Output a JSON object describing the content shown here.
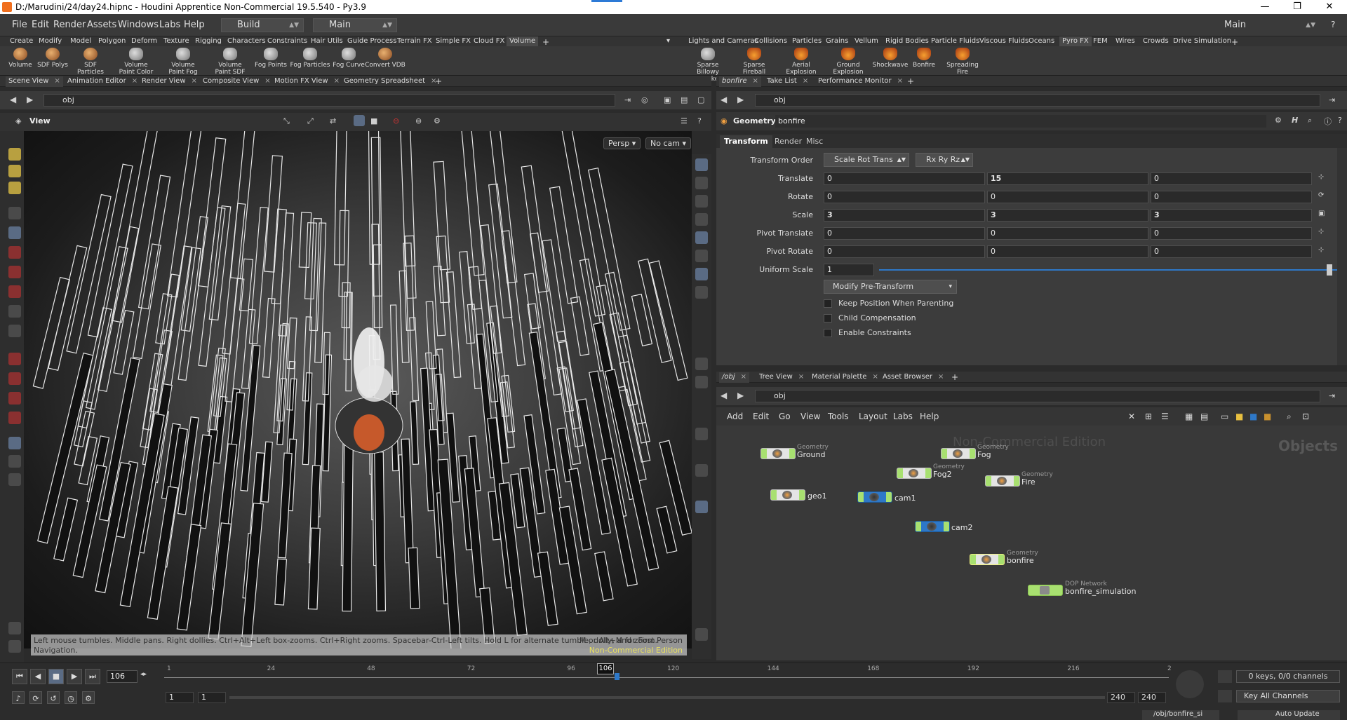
{
  "window": {
    "title": "D:/Marudini/24/day24.hipnc - Houdini Apprentice Non-Commercial 19.5.540 - Py3.9",
    "controls": [
      "—",
      "❐",
      "✕"
    ]
  },
  "menubar": {
    "items": [
      "File",
      "Edit",
      "Render",
      "Assets",
      "Windows",
      "Labs",
      "Help"
    ],
    "desktop": "Build",
    "context_left": "Main",
    "context_right": "Main"
  },
  "shelf_left": {
    "tabs": [
      "Create",
      "Modify",
      "Model",
      "Polygon",
      "Deform",
      "Texture",
      "Rigging",
      "Characters",
      "Constraints",
      "Hair Utils",
      "Guide Process",
      "Terrain FX",
      "Simple FX",
      "Cloud FX",
      "Volume"
    ],
    "active_tab": "Volume",
    "tools": [
      {
        "label": "Volume",
        "icon": "volume-icon"
      },
      {
        "label": "SDF Polys",
        "icon": "sdf-polys-icon"
      },
      {
        "label": "SDF Particles",
        "icon": "sdf-particles-icon"
      },
      {
        "label": "Volume Paint Color",
        "icon": "volume-paint-color-icon"
      },
      {
        "label": "Volume Paint Fog",
        "icon": "volume-paint-fog-icon"
      },
      {
        "label": "Volume Paint SDF",
        "icon": "volume-paint-sdf-icon"
      },
      {
        "label": "Fog Points",
        "icon": "fog-points-icon"
      },
      {
        "label": "Fog Particles",
        "icon": "fog-particles-icon"
      },
      {
        "label": "Fog Curve",
        "icon": "fog-curve-icon"
      },
      {
        "label": "Convert VDB",
        "icon": "convert-vdb-icon"
      }
    ]
  },
  "shelf_right": {
    "tabs": [
      "Lights and Cameras",
      "Collisions",
      "Particles",
      "Grains",
      "Vellum",
      "Rigid Bodies",
      "Particle Fluids",
      "Viscous Fluids",
      "Oceans",
      "Pyro FX",
      "FEM",
      "Wires",
      "Crowds",
      "Drive Simulation"
    ],
    "active_tab": "Pyro FX",
    "tools": [
      {
        "label": "Sparse Billowy Smoke",
        "icon": "billowy-smoke-icon"
      },
      {
        "label": "Sparse Fireball",
        "icon": "fireball-icon"
      },
      {
        "label": "Aerial Explosion",
        "icon": "aerial-explosion-icon"
      },
      {
        "label": "Ground Explosion",
        "icon": "ground-explosion-icon"
      },
      {
        "label": "Shockwave",
        "icon": "shockwave-icon"
      },
      {
        "label": "Bonfire",
        "icon": "bonfire-icon"
      },
      {
        "label": "Spreading Fire",
        "icon": "spreading-fire-icon"
      }
    ]
  },
  "left_pane": {
    "tabs": [
      "Scene View",
      "Animation Editor",
      "Render View",
      "Composite View",
      "Motion FX View",
      "Geometry Spreadsheet"
    ],
    "path": "obj",
    "view_title": "View",
    "persp_button": "Persp",
    "cam_button": "No cam",
    "status_message": "Left mouse tumbles. Middle pans. Right dollies. Ctrl+Alt+Left box-zooms. Ctrl+Right zooms. Spacebar-Ctrl-Left tilts. Hold L for alternate tumble, dolly, and zoom.",
    "status_message2": "Navigation.",
    "status_hint": "M or Alt+M for First Person",
    "watermark": "Non-Commercial Edition"
  },
  "param_pane": {
    "tabs": [
      "bonfire",
      "Take List",
      "Performance Monitor"
    ],
    "path": "obj",
    "node_type": "Geometry",
    "node_name": "bonfire",
    "param_tabs": [
      "Transform",
      "Render",
      "Misc"
    ],
    "active_param_tab": "Transform",
    "transform_order_label": "Transform Order",
    "transform_order": "Scale Rot Trans",
    "rotate_order": "Rx Ry Rz",
    "rows": [
      {
        "label": "Translate",
        "values": [
          "0",
          "15",
          "0"
        ],
        "bold": [
          false,
          true,
          false
        ]
      },
      {
        "label": "Rotate",
        "values": [
          "0",
          "0",
          "0"
        ],
        "bold": [
          false,
          false,
          false
        ]
      },
      {
        "label": "Scale",
        "values": [
          "3",
          "3",
          "3"
        ],
        "bold": [
          true,
          true,
          true
        ]
      },
      {
        "label": "Pivot Translate",
        "values": [
          "0",
          "0",
          "0"
        ],
        "bold": [
          false,
          false,
          false
        ]
      },
      {
        "label": "Pivot Rotate",
        "values": [
          "0",
          "0",
          "0"
        ],
        "bold": [
          false,
          false,
          false
        ]
      }
    ],
    "uniform_scale_label": "Uniform Scale",
    "uniform_scale": "1",
    "modify_button": "Modify Pre-Transform",
    "checkboxes": [
      "Keep Position When Parenting",
      "Child Compensation",
      "Enable Constraints"
    ]
  },
  "network_pane": {
    "tabs": [
      "/obj",
      "Tree View",
      "Material Palette",
      "Asset Browser"
    ],
    "path": "obj",
    "menu": [
      "Add",
      "Edit",
      "Go",
      "View",
      "Tools",
      "Layout",
      "Labs",
      "Help"
    ],
    "watermark": "Non-Commercial Edition",
    "context_label": "Objects",
    "nodes": [
      {
        "name": "Ground",
        "type": "Geometry",
        "kind": "geo"
      },
      {
        "name": "Fog",
        "type": "Geometry",
        "kind": "geo"
      },
      {
        "name": "Fog2",
        "type": "Geometry",
        "kind": "geo"
      },
      {
        "name": "Fire",
        "type": "Geometry",
        "kind": "geo"
      },
      {
        "name": "geo1",
        "type": "",
        "kind": "geo"
      },
      {
        "name": "cam1",
        "type": "",
        "kind": "cam"
      },
      {
        "name": "cam2",
        "type": "",
        "kind": "cam"
      },
      {
        "name": "bonfire",
        "type": "Geometry",
        "kind": "geo"
      },
      {
        "name": "bonfire_simulation",
        "type": "DOP Network",
        "kind": "dop"
      }
    ]
  },
  "timeline": {
    "current_frame": "106",
    "ticks": [
      "1",
      "24",
      "48",
      "72",
      "96",
      "120",
      "144",
      "168",
      "192",
      "216",
      "2"
    ],
    "range_start": "1",
    "range_start2": "1",
    "range_end": "240",
    "range_end2": "240",
    "keys_info": "0 keys, 0/0 channels",
    "key_channels": "Key All Channels",
    "path_field": "/obj/bonfire_si",
    "auto_update": "Auto Update"
  }
}
